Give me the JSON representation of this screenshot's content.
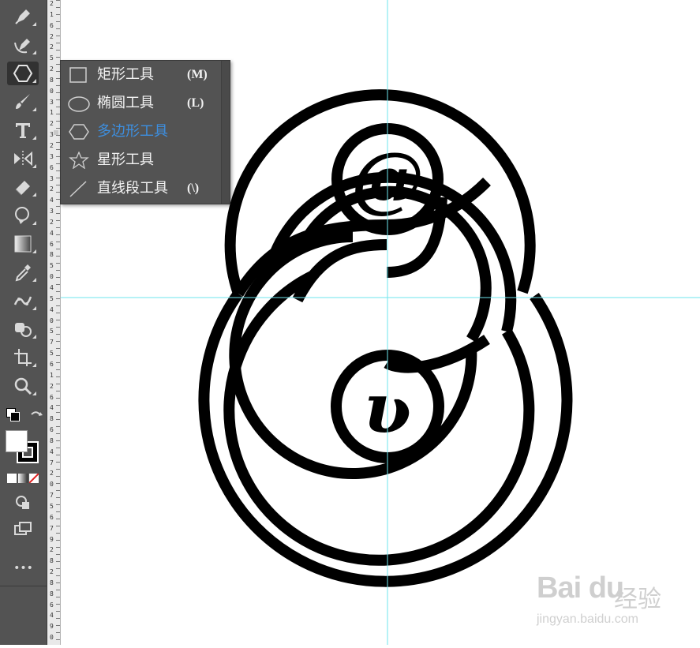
{
  "toolbar": {
    "tools": [
      "pen-tool",
      "curvature-tool",
      "shape-tool",
      "paintbrush-tool",
      "type-tool",
      "reflect-tool",
      "eraser-tool",
      "warp-tool",
      "gradient-tool",
      "eyedropper-tool",
      "puppet-warp-tool",
      "shape-builder-tool",
      "artboard-tool",
      "zoom-tool"
    ],
    "more_label": "•••"
  },
  "ruler": {
    "digits": [
      "2",
      "1",
      "6",
      "2",
      "2",
      "5",
      "2",
      "8",
      "0",
      "3",
      "1",
      "2",
      "3",
      "2",
      "3",
      "6",
      "3",
      "2",
      "4",
      "3",
      "2",
      "4",
      "6",
      "8",
      "5",
      "0",
      "4",
      "5",
      "4",
      "0",
      "5",
      "7",
      "5",
      "6",
      "1",
      "2",
      "6",
      "4",
      "8",
      "6",
      "8",
      "4",
      "7",
      "2",
      "0",
      "7",
      "5",
      "6",
      "7",
      "9",
      "2",
      "8",
      "2",
      "8",
      "8",
      "6",
      "4",
      "9",
      "0"
    ]
  },
  "flyout": {
    "items": [
      {
        "label": "矩形工具",
        "shortcut": "(M)",
        "icon": "rectangle-icon"
      },
      {
        "label": "椭圆工具",
        "shortcut": "(L)",
        "icon": "ellipse-icon"
      },
      {
        "label": "多边形工具",
        "shortcut": "",
        "icon": "polygon-icon",
        "selected": true
      },
      {
        "label": "星形工具",
        "shortcut": "",
        "icon": "star-icon"
      },
      {
        "label": "直线段工具",
        "shortcut": "(\\)",
        "icon": "line-icon"
      }
    ]
  },
  "artwork": {
    "top_glyph": "@",
    "bottom_glyph": "ʋ"
  },
  "guides": {
    "color": "#6ee6ee"
  },
  "accent": "#3d8fe0",
  "watermark": {
    "logo": "Bai du",
    "cn": "经验",
    "url": "jingyan.baidu.com"
  }
}
